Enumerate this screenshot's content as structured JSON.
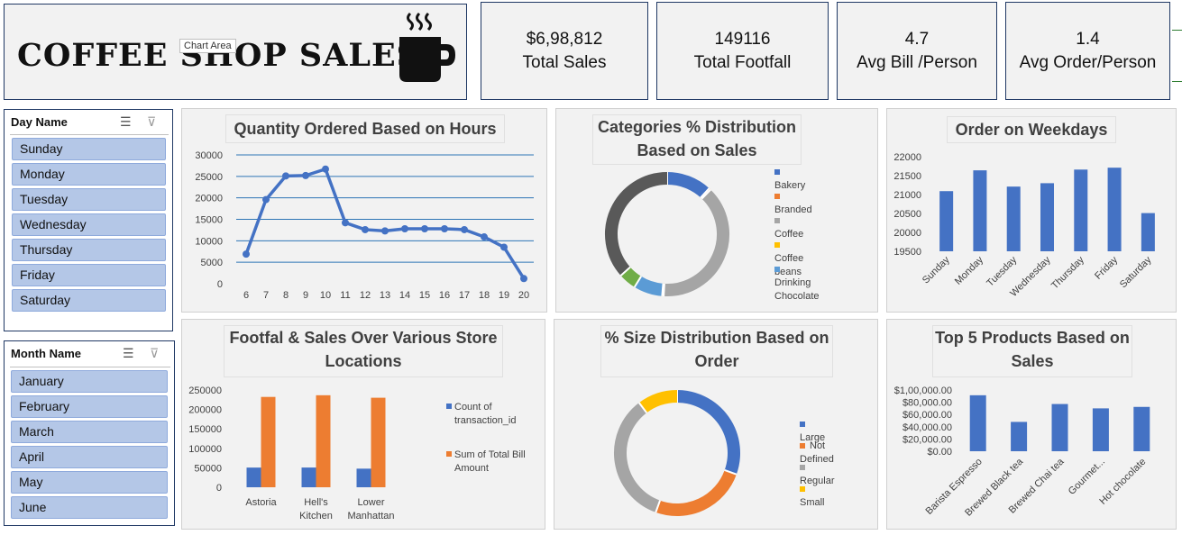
{
  "header": {
    "title": "COFFEE SHOP SALES",
    "tooltip": "Chart Area"
  },
  "kpis": [
    {
      "value": "$6,98,812",
      "label": "Total Sales"
    },
    {
      "value": "149116",
      "label": "Total Footfall"
    },
    {
      "value": "4.7",
      "label": "Avg Bill /Person"
    },
    {
      "value": "1.4",
      "label": "Avg Order/Person"
    }
  ],
  "slicers": {
    "day": {
      "title": "Day Name",
      "items": [
        "Sunday",
        "Monday",
        "Tuesday",
        "Wednesday",
        "Thursday",
        "Friday",
        "Saturday"
      ]
    },
    "month": {
      "title": "Month Name",
      "items": [
        "January",
        "February",
        "March",
        "April",
        "May",
        "June"
      ]
    }
  },
  "colors": {
    "blue": "#4472c4",
    "orange": "#ed7d31",
    "gray": "#a5a5a5",
    "yellow": "#ffc000",
    "lightblue": "#5b9bd5",
    "green": "#70ad47",
    "darkgray": "#595959"
  },
  "chart_data": [
    {
      "type": "line",
      "title": "Quantity Ordered Based on Hours",
      "x": [
        6,
        7,
        8,
        9,
        10,
        11,
        12,
        13,
        14,
        15,
        16,
        17,
        18,
        19,
        20
      ],
      "values": [
        6900,
        19600,
        25100,
        25200,
        26700,
        14200,
        12600,
        12300,
        12800,
        12800,
        12800,
        12600,
        10900,
        8500,
        1200
      ],
      "ylim": [
        0,
        30000
      ],
      "yticks": [
        0,
        5000,
        10000,
        15000,
        20000,
        25000,
        30000
      ]
    },
    {
      "type": "pie",
      "title": "Categories % Distribution Based on Sales",
      "labels": [
        "Bakery",
        "Branded",
        "Coffee",
        "Coffee beans",
        "Drinking Chocolate"
      ],
      "slices": [
        {
          "label": "Bakery",
          "value": 11.8
        },
        {
          "label": "Branded",
          "value": 0.5
        },
        {
          "label": "Coffee",
          "value": 38.6
        },
        {
          "label": "Coffee beans",
          "value": 0.4
        },
        {
          "label": "Drinking Chocolate",
          "value": 7.5
        },
        {
          "label": "",
          "value": 4.6
        },
        {
          "label": "",
          "value": 36.6
        }
      ]
    },
    {
      "type": "bar",
      "title": "Order on Weekdays",
      "categories": [
        "Sunday",
        "Monday",
        "Tuesday",
        "Wednesday",
        "Thursday",
        "Friday",
        "Saturday"
      ],
      "values": [
        21090,
        21640,
        21210,
        21300,
        21660,
        21710,
        20510
      ],
      "ylim": [
        19500,
        22000
      ],
      "yticks": [
        19500,
        20000,
        20500,
        21000,
        21500,
        22000
      ]
    },
    {
      "type": "bar",
      "title": "Footfal & Sales Over Various Store Locations",
      "categories": [
        "Astoria",
        "Hell's Kitchen",
        "Lower Manhattan"
      ],
      "category_lines": [
        [
          "Astoria"
        ],
        [
          "Hell's",
          "Kitchen"
        ],
        [
          "Lower",
          "Manhattan"
        ]
      ],
      "series": [
        {
          "name": "Count of transaction_id",
          "name_lines": [
            "Count of",
            "transaction_id"
          ],
          "values": [
            50600,
            50700,
            47800
          ]
        },
        {
          "name": "Sum of Total Bill Amount",
          "name_lines": [
            "Sum of Total Bill",
            "Amount"
          ],
          "values": [
            232200,
            236500,
            230100
          ]
        }
      ],
      "ylim": [
        0,
        250000
      ],
      "yticks": [
        0,
        50000,
        100000,
        150000,
        200000,
        250000
      ]
    },
    {
      "type": "pie",
      "title": "% Size Distribution Based on Order",
      "labels": [
        "Large",
        "Not Defined",
        "Regular",
        "Small"
      ],
      "slices": [
        {
          "label": "Large",
          "value": 30.5
        },
        {
          "label": "Not Defined",
          "value": 25.0
        },
        {
          "label": "Regular",
          "value": 34.2
        },
        {
          "label": "Small",
          "value": 10.3
        }
      ]
    },
    {
      "type": "bar",
      "title": "Top 5 Products Based on Sales",
      "categories": [
        "Barista Espresso",
        "Brewed Black tea",
        "Brewed Chai tea",
        "Gourmet...",
        "Hot chocolate"
      ],
      "values": [
        91400,
        47900,
        77100,
        70000,
        72400
      ],
      "ylim": [
        0,
        100000
      ],
      "yticks": [
        "$0.00",
        "$20,000.00",
        "$40,000.00",
        "$60,000.00",
        "$80,000.00",
        "$1,00,000.00"
      ]
    }
  ]
}
